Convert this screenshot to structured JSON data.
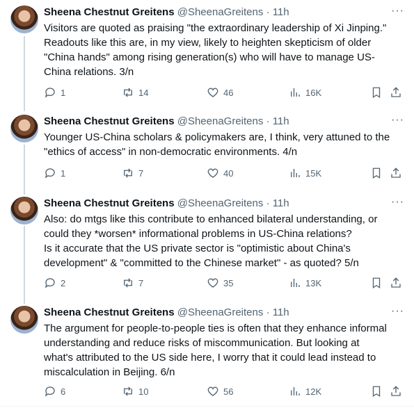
{
  "tweets": [
    {
      "name": "Sheena Chestnut Greitens",
      "handle": "@SheenaGreitens",
      "dot": "·",
      "time": "11h",
      "text": "Visitors are quoted as praising \"the extraordinary leadership of Xi Jinping.\"\nReadouts like this are, in my view, likely to heighten skepticism of older\n\"China hands\" among rising generation(s) who will have to manage US-\nChina relations. 3/n",
      "replies": "1",
      "reposts": "14",
      "likes": "46",
      "views": "16K"
    },
    {
      "name": "Sheena Chestnut Greitens",
      "handle": "@SheenaGreitens",
      "dot": "·",
      "time": "11h",
      "text": "Younger US-China scholars & policymakers are, I think, very attuned to the\n\"ethics of access\" in non-democratic environments.  4/n",
      "replies": "1",
      "reposts": "7",
      "likes": "40",
      "views": "15K"
    },
    {
      "name": "Sheena Chestnut Greitens",
      "handle": "@SheenaGreitens",
      "dot": "·",
      "time": "11h",
      "text": "Also: do mtgs like this contribute to enhanced bilateral understanding, or\ncould they *worsen* informational problems in US-China relations?\nIs it accurate that the US private sector is \"optimistic about China's\ndevelopment\" & \"committed to the Chinese market\" - as quoted?  5/n",
      "replies": "2",
      "reposts": "7",
      "likes": "35",
      "views": "13K"
    },
    {
      "name": "Sheena Chestnut Greitens",
      "handle": "@SheenaGreitens",
      "dot": "·",
      "time": "11h",
      "text": "The argument for people-to-people ties is often that they enhance informal\nunderstanding and reduce risks of miscommunication.  But looking at\nwhat's attributed to the US side here, I worry that it could lead instead to\nmiscalculation in Beijing. 6/n",
      "replies": "6",
      "reposts": "10",
      "likes": "56",
      "views": "12K"
    }
  ],
  "icons": {
    "reply": "reply-icon",
    "repost": "repost-icon",
    "like": "heart-icon",
    "views": "views-icon",
    "bookmark": "bookmark-icon",
    "share": "share-icon",
    "more": "more-icon"
  },
  "more_label": "···"
}
